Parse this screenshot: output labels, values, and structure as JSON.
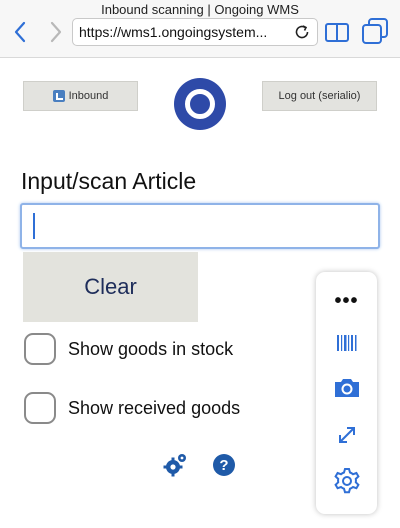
{
  "browser": {
    "page_title": "Inbound scanning | Ongoing WMS",
    "url": "https://wms1.ongoingsystem..."
  },
  "header": {
    "inbound_label": "Inbound",
    "logout_label": "Log out (serialio)"
  },
  "form": {
    "field_label": "Input/scan Article",
    "input_value": "",
    "clear_label": "Clear",
    "checkboxes": [
      {
        "label": "Show goods in stock",
        "checked": false
      },
      {
        "label": "Show received goods",
        "checked": false
      }
    ]
  },
  "toolbar": {
    "more_label": "•••",
    "icons": [
      "barcode-icon",
      "camera-icon",
      "expand-icon",
      "settings-icon"
    ]
  },
  "footer": {
    "help_label": "?"
  },
  "colors": {
    "accent": "#2f6fd6",
    "logo": "#2e4aa8",
    "help": "#1f5aa8"
  }
}
